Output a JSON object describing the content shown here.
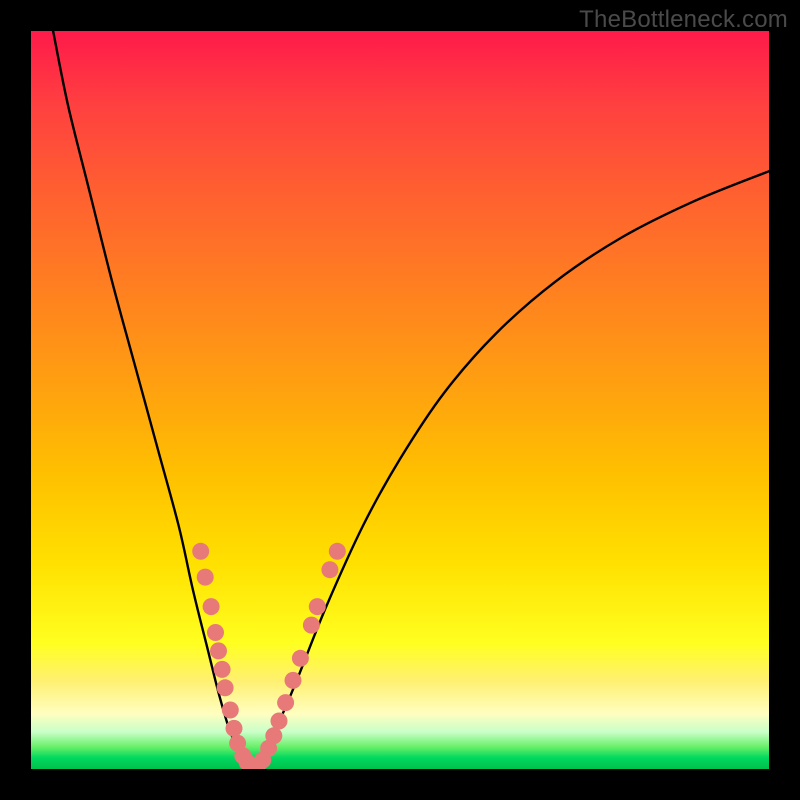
{
  "watermark": "TheBottleneck.com",
  "colors": {
    "frame": "#000000",
    "curve": "#000000",
    "dot_fill": "#e77a78",
    "dot_stroke": "rgba(0,0,0,0)"
  },
  "chart_data": {
    "type": "line",
    "title": "",
    "xlabel": "",
    "ylabel": "",
    "xlim": [
      0,
      100
    ],
    "ylim": [
      0,
      100
    ],
    "series": [
      {
        "name": "bottleneck-curve",
        "x": [
          3,
          5,
          8,
          11,
          14,
          17,
          20,
          22,
          24,
          25.5,
          27,
          28.5,
          30,
          31,
          33,
          36,
          40,
          45,
          50,
          56,
          63,
          71,
          80,
          90,
          100
        ],
        "y": [
          100,
          90,
          78,
          66,
          55,
          44,
          33,
          24,
          16,
          10,
          5,
          2,
          0,
          1,
          5,
          12,
          22,
          33,
          42,
          51,
          59,
          66,
          72,
          77,
          81
        ]
      }
    ],
    "data_points": [
      {
        "x": 23.0,
        "y": 29.5
      },
      {
        "x": 23.6,
        "y": 26.0
      },
      {
        "x": 24.4,
        "y": 22.0
      },
      {
        "x": 25.0,
        "y": 18.5
      },
      {
        "x": 25.4,
        "y": 16.0
      },
      {
        "x": 25.9,
        "y": 13.5
      },
      {
        "x": 26.3,
        "y": 11.0
      },
      {
        "x": 27.0,
        "y": 8.0
      },
      {
        "x": 27.5,
        "y": 5.5
      },
      {
        "x": 28.0,
        "y": 3.5
      },
      {
        "x": 28.7,
        "y": 1.8
      },
      {
        "x": 29.3,
        "y": 0.9
      },
      {
        "x": 30.0,
        "y": 0.5
      },
      {
        "x": 30.8,
        "y": 0.6
      },
      {
        "x": 31.4,
        "y": 1.2
      },
      {
        "x": 32.2,
        "y": 2.8
      },
      {
        "x": 32.9,
        "y": 4.5
      },
      {
        "x": 33.6,
        "y": 6.5
      },
      {
        "x": 34.5,
        "y": 9.0
      },
      {
        "x": 35.5,
        "y": 12.0
      },
      {
        "x": 36.5,
        "y": 15.0
      },
      {
        "x": 38.0,
        "y": 19.5
      },
      {
        "x": 38.8,
        "y": 22.0
      },
      {
        "x": 40.5,
        "y": 27.0
      },
      {
        "x": 41.5,
        "y": 29.5
      }
    ]
  }
}
